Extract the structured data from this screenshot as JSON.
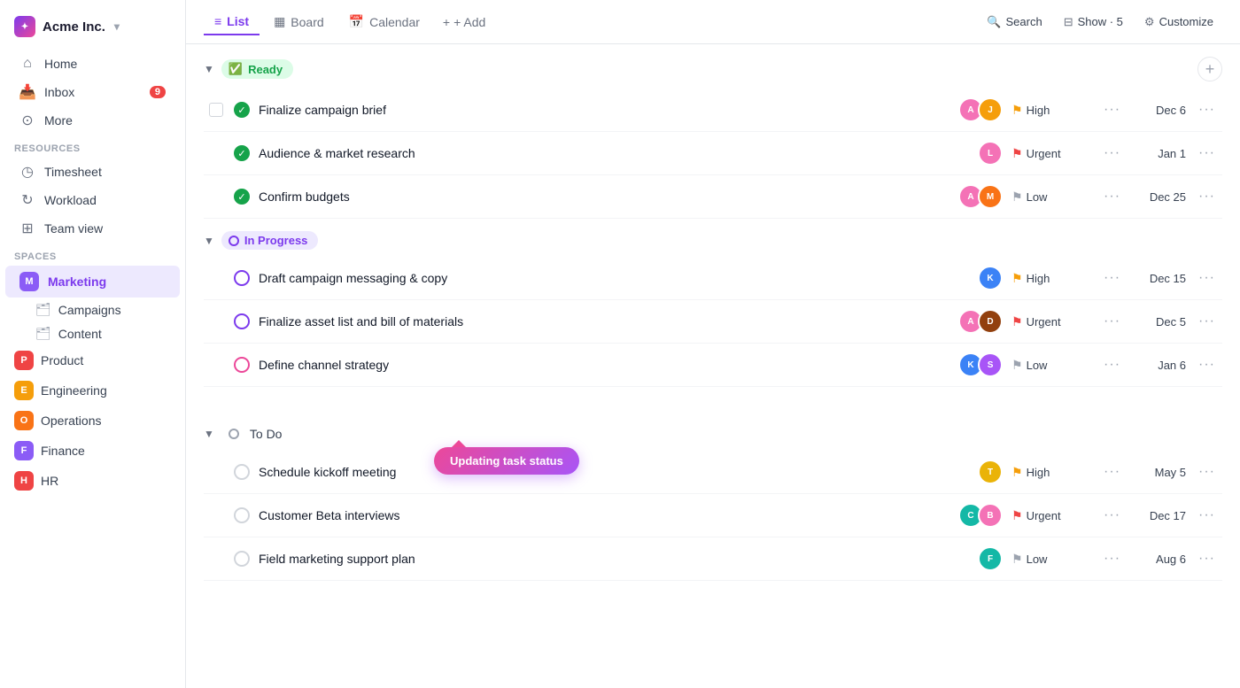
{
  "app": {
    "name": "Acme Inc.",
    "logo_text": "✦"
  },
  "sidebar": {
    "nav_items": [
      {
        "id": "home",
        "label": "Home",
        "icon": "🏠"
      },
      {
        "id": "inbox",
        "label": "Inbox",
        "icon": "📥",
        "badge": "9"
      },
      {
        "id": "more",
        "label": "More",
        "icon": "⊙"
      }
    ],
    "resources_label": "Resources",
    "resource_items": [
      {
        "id": "timesheet",
        "label": "Timesheet",
        "icon": "⏱"
      },
      {
        "id": "workload",
        "label": "Workload",
        "icon": "↻"
      },
      {
        "id": "teamview",
        "label": "Team view",
        "icon": "⊞"
      }
    ],
    "spaces_label": "Spaces",
    "spaces": [
      {
        "id": "marketing",
        "label": "Marketing",
        "color": "#8b5cf6",
        "letter": "M",
        "active": true
      },
      {
        "id": "product",
        "label": "Product",
        "color": "#ef4444",
        "letter": "P"
      },
      {
        "id": "engineering",
        "label": "Engineering",
        "color": "#f59e0b",
        "letter": "E"
      },
      {
        "id": "operations",
        "label": "Operations",
        "color": "#f97316",
        "letter": "O"
      },
      {
        "id": "finance",
        "label": "Finance",
        "color": "#8b5cf6",
        "letter": "F"
      },
      {
        "id": "hr",
        "label": "HR",
        "color": "#ef4444",
        "letter": "H"
      }
    ],
    "sub_items": [
      {
        "id": "campaigns",
        "label": "Campaigns"
      },
      {
        "id": "content",
        "label": "Content"
      }
    ]
  },
  "topbar": {
    "tabs": [
      {
        "id": "list",
        "label": "List",
        "icon": "≡",
        "active": true
      },
      {
        "id": "board",
        "label": "Board",
        "icon": "▦"
      },
      {
        "id": "calendar",
        "label": "Calendar",
        "icon": "📅"
      }
    ],
    "add_label": "+ Add",
    "search_label": "Search",
    "show_label": "Show · 5",
    "customize_label": "Customize"
  },
  "sections": [
    {
      "id": "ready",
      "label": "Ready",
      "status": "ready",
      "tasks": [
        {
          "id": "t1",
          "name": "Finalize campaign brief",
          "avatars": [
            {
              "color": "#f472b6",
              "letter": "A"
            },
            {
              "color": "#f59e0b",
              "letter": "J"
            }
          ],
          "priority": "High",
          "priority_level": "high",
          "date": "Dec 6",
          "checkbox_state": "checked",
          "has_select": true
        },
        {
          "id": "t2",
          "name": "Audience & market research",
          "avatars": [
            {
              "color": "#f472b6",
              "letter": "L"
            }
          ],
          "priority": "Urgent",
          "priority_level": "urgent",
          "date": "Jan 1",
          "checkbox_state": "checked"
        },
        {
          "id": "t3",
          "name": "Confirm budgets",
          "avatars": [
            {
              "color": "#f472b6",
              "letter": "A"
            },
            {
              "color": "#f97316",
              "letter": "M"
            }
          ],
          "priority": "Low",
          "priority_level": "low",
          "date": "Dec 25",
          "checkbox_state": "checked"
        }
      ]
    },
    {
      "id": "inprogress",
      "label": "In Progress",
      "status": "inprogress",
      "tasks": [
        {
          "id": "t4",
          "name": "Draft campaign messaging & copy",
          "avatars": [
            {
              "color": "#3b82f6",
              "letter": "K"
            }
          ],
          "priority": "High",
          "priority_level": "high",
          "date": "Dec 15",
          "checkbox_state": "circle"
        },
        {
          "id": "t5",
          "name": "Finalize asset list and bill of materials",
          "avatars": [
            {
              "color": "#f472b6",
              "letter": "A"
            },
            {
              "color": "#92400e",
              "letter": "D"
            }
          ],
          "priority": "Urgent",
          "priority_level": "urgent",
          "date": "Dec 5",
          "checkbox_state": "circle"
        },
        {
          "id": "t6",
          "name": "Define channel strategy",
          "avatars": [
            {
              "color": "#3b82f6",
              "letter": "K"
            },
            {
              "color": "#a855f7",
              "letter": "S"
            }
          ],
          "priority": "Low",
          "priority_level": "low",
          "date": "Jan 6",
          "checkbox_state": "circle",
          "has_updating": true
        }
      ]
    },
    {
      "id": "todo",
      "label": "To Do",
      "status": "todo",
      "tasks": [
        {
          "id": "t7",
          "name": "Schedule kickoff meeting",
          "avatars": [
            {
              "color": "#eab308",
              "letter": "T"
            }
          ],
          "priority": "High",
          "priority_level": "high",
          "date": "May 5",
          "checkbox_state": "empty"
        },
        {
          "id": "t8",
          "name": "Customer Beta interviews",
          "avatars": [
            {
              "color": "#14b8a6",
              "letter": "C"
            },
            {
              "color": "#f472b6",
              "letter": "B"
            }
          ],
          "priority": "Urgent",
          "priority_level": "urgent",
          "date": "Dec 17",
          "checkbox_state": "empty"
        },
        {
          "id": "t9",
          "name": "Field marketing support plan",
          "avatars": [
            {
              "color": "#14b8a6",
              "letter": "F"
            }
          ],
          "priority": "Low",
          "priority_level": "low",
          "date": "Aug 6",
          "checkbox_state": "empty"
        }
      ]
    }
  ],
  "updating_badge_text": "Updating task status"
}
